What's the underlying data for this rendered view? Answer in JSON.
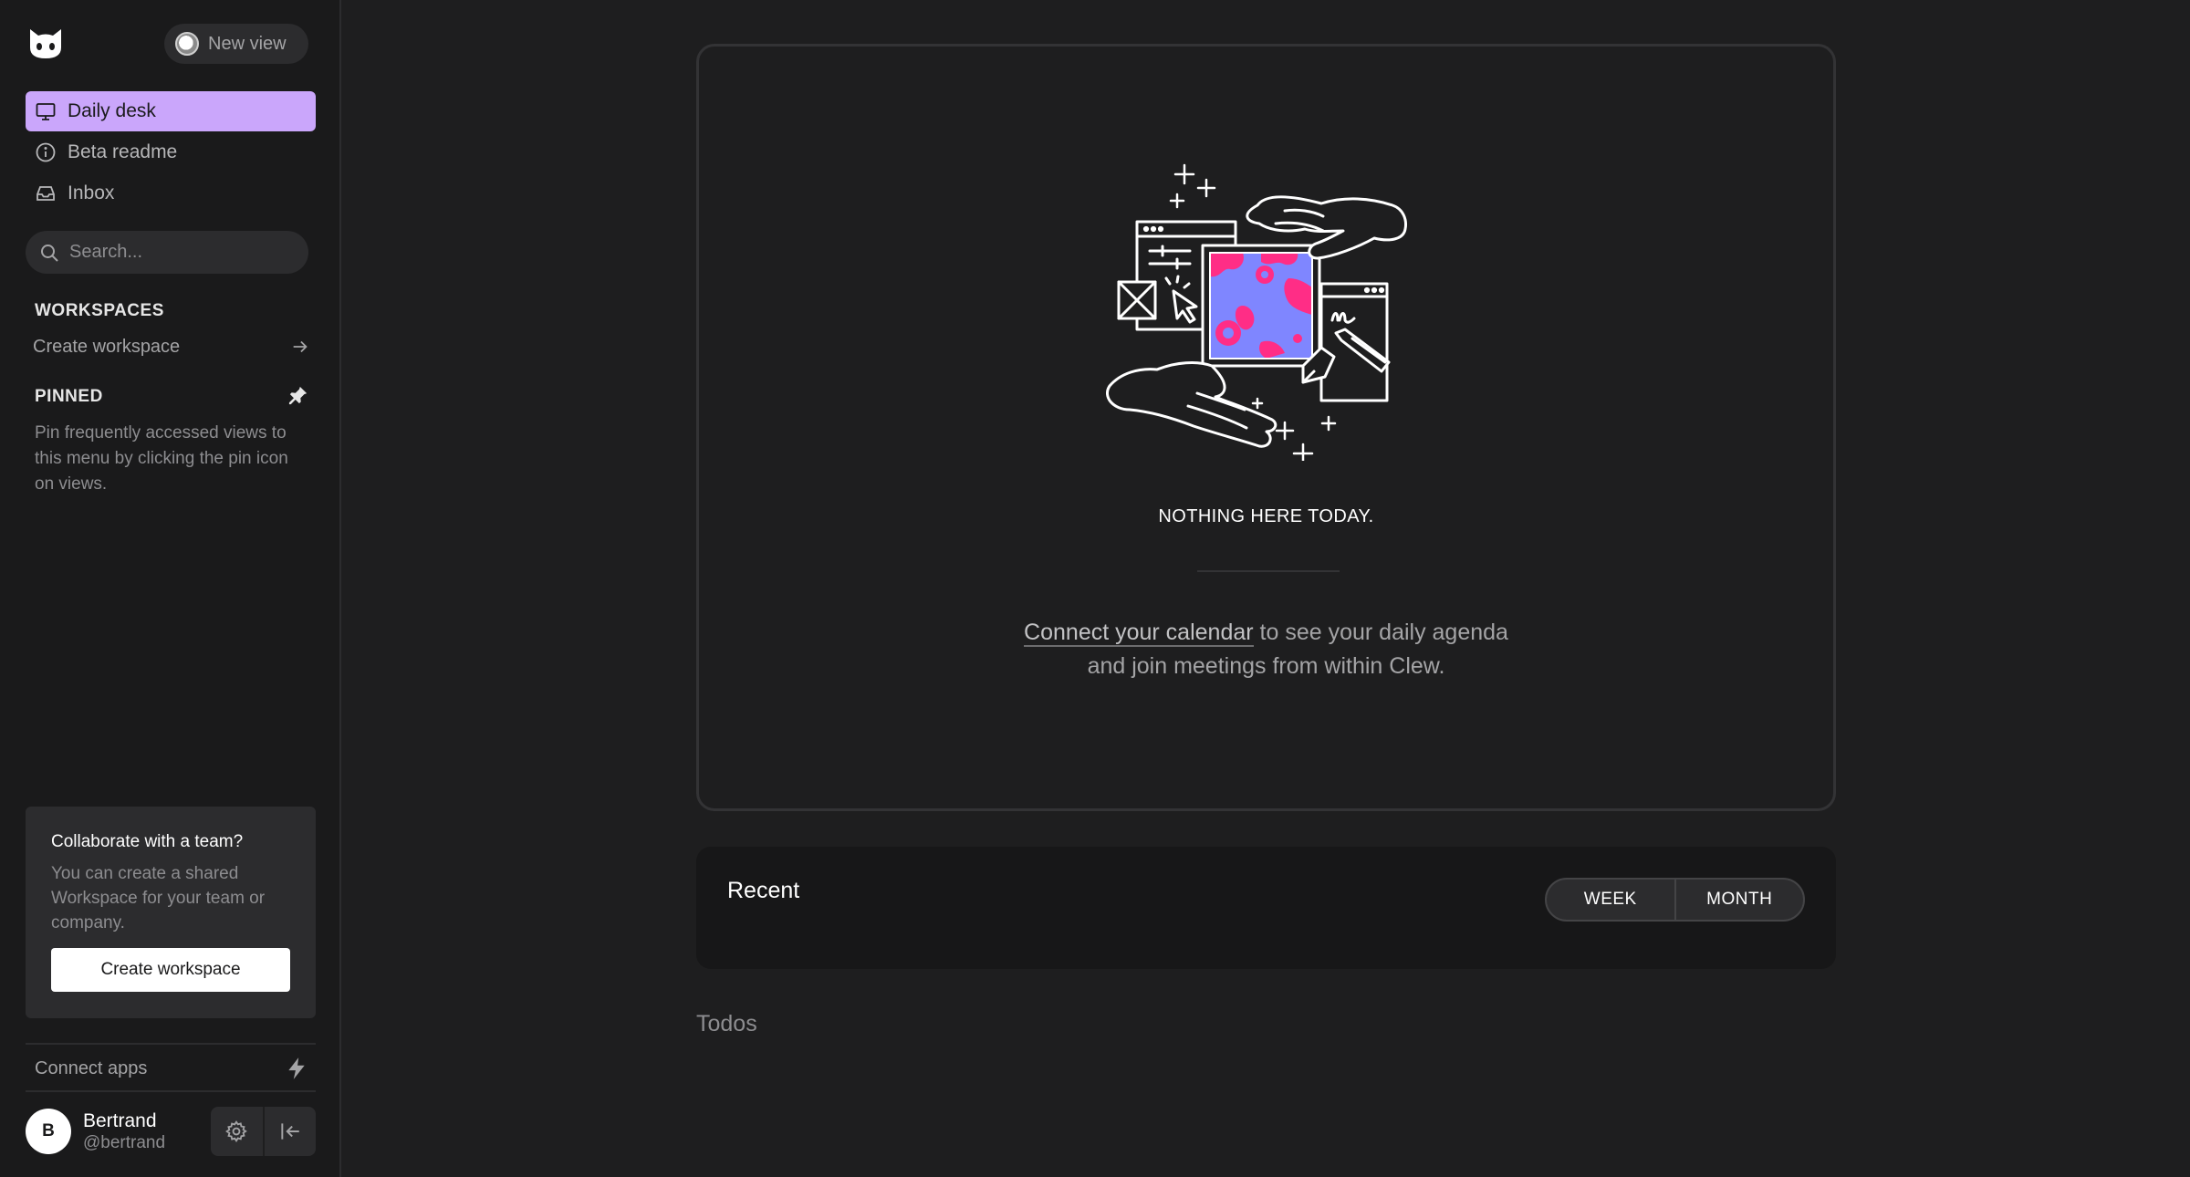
{
  "sidebar": {
    "new_view_label": "New view",
    "nav": [
      {
        "label": "Daily desk",
        "icon": "monitor-icon",
        "active": true
      },
      {
        "label": "Beta readme",
        "icon": "info-icon",
        "active": false
      },
      {
        "label": "Inbox",
        "icon": "inbox-icon",
        "active": false
      }
    ],
    "search_placeholder": "Search...",
    "workspaces_title": "WORKSPACES",
    "create_workspace_link": "Create workspace",
    "pinned_title": "PINNED",
    "pinned_hint": "Pin frequently accessed views to this menu by clicking the pin icon on views.",
    "collab": {
      "title": "Collaborate with a team?",
      "text": "You can create a shared Workspace for your team or company.",
      "button": "Create workspace"
    },
    "connect_apps": "Connect apps",
    "user": {
      "initial": "B",
      "name": "Bertrand",
      "handle": "@bertrand"
    }
  },
  "main": {
    "agenda": {
      "empty_title": "NOTHING HERE TODAY.",
      "link_text": "Connect your calendar",
      "message_rest_line1": " to see your daily agenda",
      "message_line2": "and join meetings from within Clew."
    },
    "recent": {
      "title": "Recent",
      "toggle": [
        "WEEK",
        "MONTH"
      ]
    },
    "todos_title": "Todos"
  },
  "colors": {
    "background": "#1e1e1f",
    "sidebar": "#1a1a1b",
    "accent": "#caa6fb",
    "illustration_pink": "#ff2d86",
    "illustration_blue": "#7f86ff"
  }
}
